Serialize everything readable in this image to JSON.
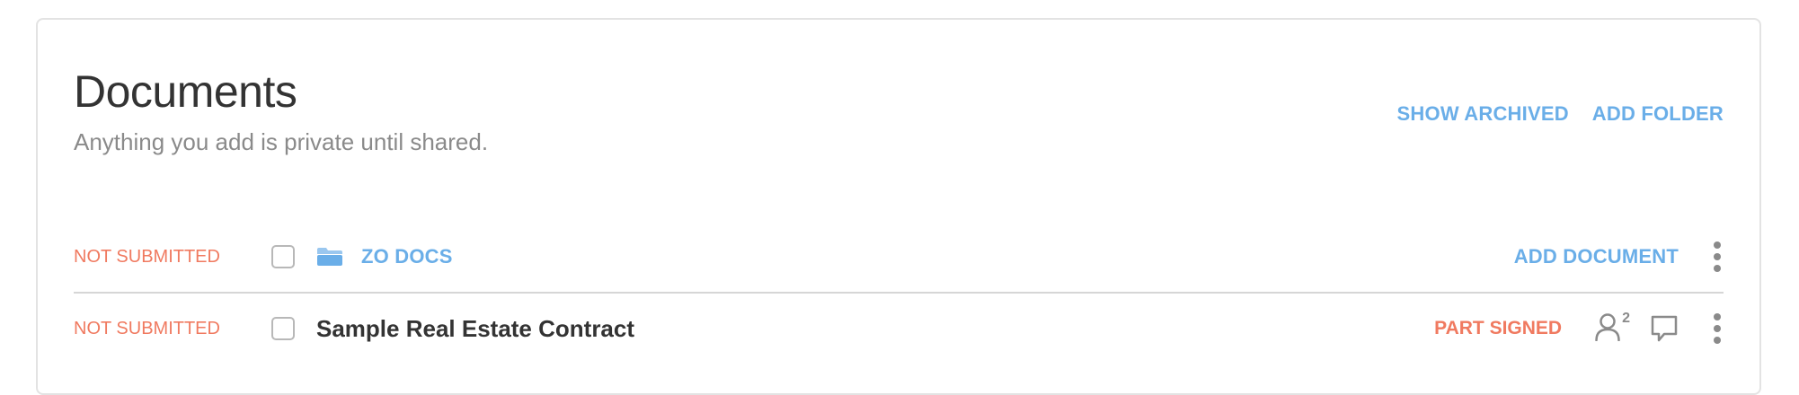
{
  "header": {
    "title": "Documents",
    "subtitle": "Anything you add is private until shared.",
    "actions": {
      "show_archived": "SHOW ARCHIVED",
      "add_folder": "ADD FOLDER"
    }
  },
  "folder_row": {
    "status": "NOT SUBMITTED",
    "name": "ZO DOCS",
    "add_document": "ADD DOCUMENT",
    "icon": "folder-icon"
  },
  "document_row": {
    "status": "NOT SUBMITTED",
    "name": "Sample Real Estate Contract",
    "sign_status": "PART SIGNED",
    "signer_count": "2",
    "icons": [
      "person-icon",
      "comment-icon",
      "more-vertical-icon"
    ]
  },
  "colors": {
    "accent_link": "#6aaee8",
    "status_warning": "#f07a60",
    "title_text": "#333333",
    "muted_text": "#8a8a8a",
    "border": "#e3e3e3"
  }
}
